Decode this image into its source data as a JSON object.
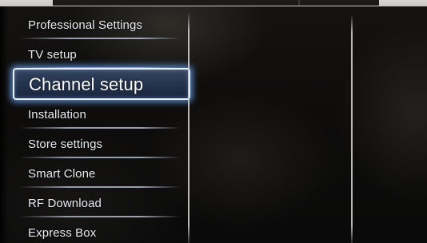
{
  "menu": {
    "items": [
      {
        "label": "Professional Settings",
        "selected": false
      },
      {
        "label": "TV setup",
        "selected": false
      },
      {
        "label": "Channel setup",
        "selected": true
      },
      {
        "label": "Installation",
        "selected": false
      },
      {
        "label": "Store settings",
        "selected": false
      },
      {
        "label": "Smart Clone",
        "selected": false
      },
      {
        "label": "RF Download",
        "selected": false
      },
      {
        "label": "Express Box",
        "selected": false
      }
    ]
  },
  "colors": {
    "text": "#e6e9ee",
    "selection_glow": "#6eaaff",
    "selection_border": "#e9f2ff",
    "background": "#0e0d0c"
  }
}
